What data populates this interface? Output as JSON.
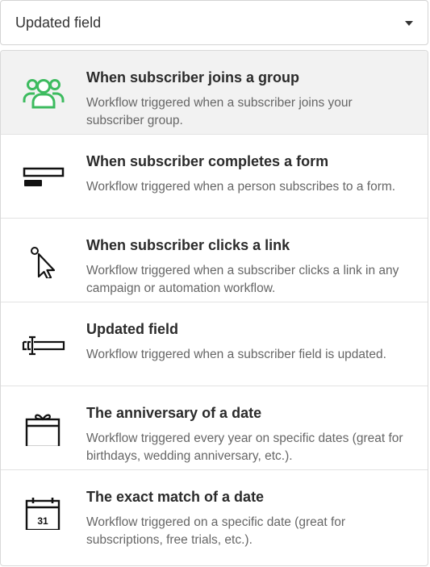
{
  "select": {
    "value": "Updated field",
    "caret_icon": "caret-down-icon"
  },
  "options": [
    {
      "icon": "group-icon",
      "title": "When subscriber joins a group",
      "description": "Workflow triggered when a subscriber joins your subscriber group.",
      "active": true,
      "icon_color": "#3dbb5f"
    },
    {
      "icon": "form-icon",
      "title": "When subscriber completes a form",
      "description": "Workflow triggered when a person subscribes to a form."
    },
    {
      "icon": "cursor-click-icon",
      "title": "When subscriber clicks a link",
      "description": "Workflow triggered when a subscriber clicks a link in any campaign or automation workflow."
    },
    {
      "icon": "text-field-icon",
      "title": "Updated field",
      "description": "Workflow triggered when a subscriber field is updated."
    },
    {
      "icon": "gift-icon",
      "title": "The anniversary of a date",
      "description": "Workflow triggered every year on specific dates (great for birthdays, wedding anniversary, etc.)."
    },
    {
      "icon": "calendar-icon",
      "title": "The exact match of a date",
      "description": "Workflow triggered on a specific date (great for subscriptions, free trials, etc.).",
      "calendar_day": "31"
    }
  ]
}
